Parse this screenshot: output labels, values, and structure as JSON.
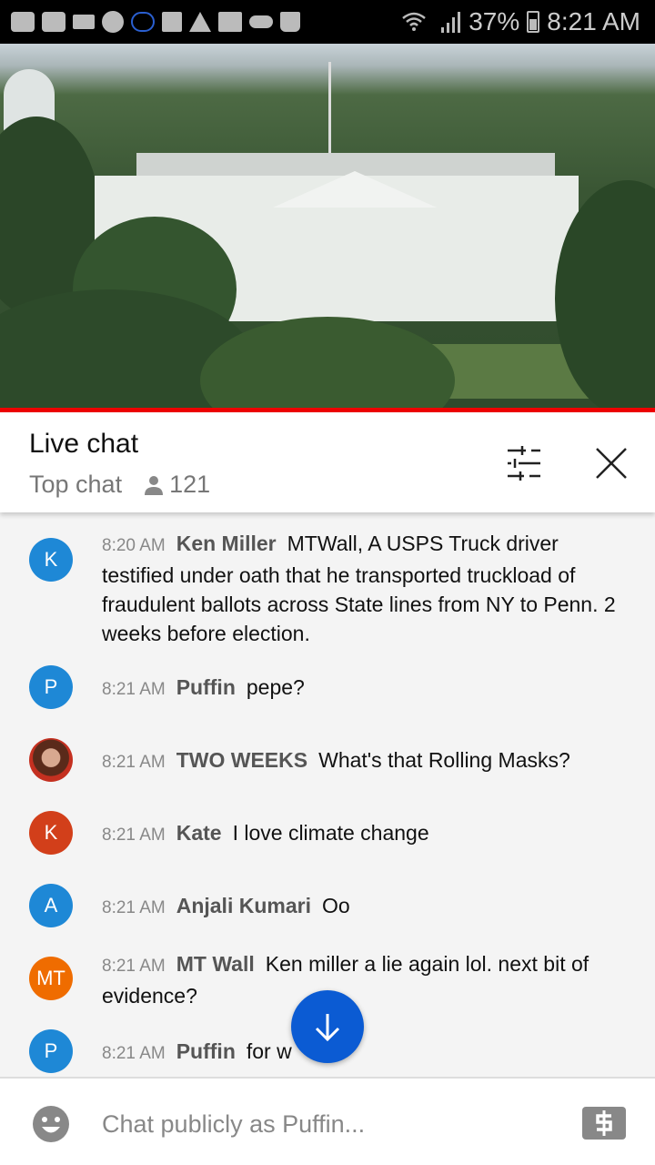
{
  "status_bar": {
    "left_icons": [
      "youtube-icon",
      "youtube-icon",
      "crown-icon",
      "m-app-icon",
      "cloud-outline-icon",
      "folder-icon",
      "warning-icon",
      "image-icon",
      "cloud-icon",
      "shopping-bag-icon"
    ],
    "battery": "37%",
    "time": "8:21 AM"
  },
  "video": {
    "progress_percent": 100,
    "accent_color": "#ee0000"
  },
  "chat_header": {
    "title": "Live chat",
    "mode": "Top chat",
    "viewer_count": "121"
  },
  "messages": [
    {
      "avatar_letter": "K",
      "avatar_color": "#1e88d6",
      "time": "8:20 AM",
      "author": "Ken Miller",
      "text": "MTWall, A USPS Truck driver testified under oath that he transported truckload of fraudulent ballots across State lines from NY to Penn. 2 weeks before election."
    },
    {
      "avatar_letter": "P",
      "avatar_color": "#1e88d6",
      "time": "8:21 AM",
      "author": "Puffin",
      "text": "pepe?"
    },
    {
      "avatar_letter": "",
      "avatar_color": "#8a3b2a",
      "time": "8:21 AM",
      "author": "TWO WEEKS",
      "text": "What's that Rolling Masks?"
    },
    {
      "avatar_letter": "K",
      "avatar_color": "#d23f1a",
      "time": "8:21 AM",
      "author": "Kate",
      "text": "I love climate change"
    },
    {
      "avatar_letter": "A",
      "avatar_color": "#1e88d6",
      "time": "8:21 AM",
      "author": "Anjali Kumari",
      "text": "Oo"
    },
    {
      "avatar_letter": "MT",
      "avatar_color": "#ef6c00",
      "time": "8:21 AM",
      "author": "MT Wall",
      "text": "Ken miller a lie again lol. next bit of evidence?"
    },
    {
      "avatar_letter": "P",
      "avatar_color": "#1e88d6",
      "time": "8:21 AM",
      "author": "Puffin",
      "text": "for w"
    }
  ],
  "input": {
    "placeholder": "Chat publicly as Puffin..."
  }
}
